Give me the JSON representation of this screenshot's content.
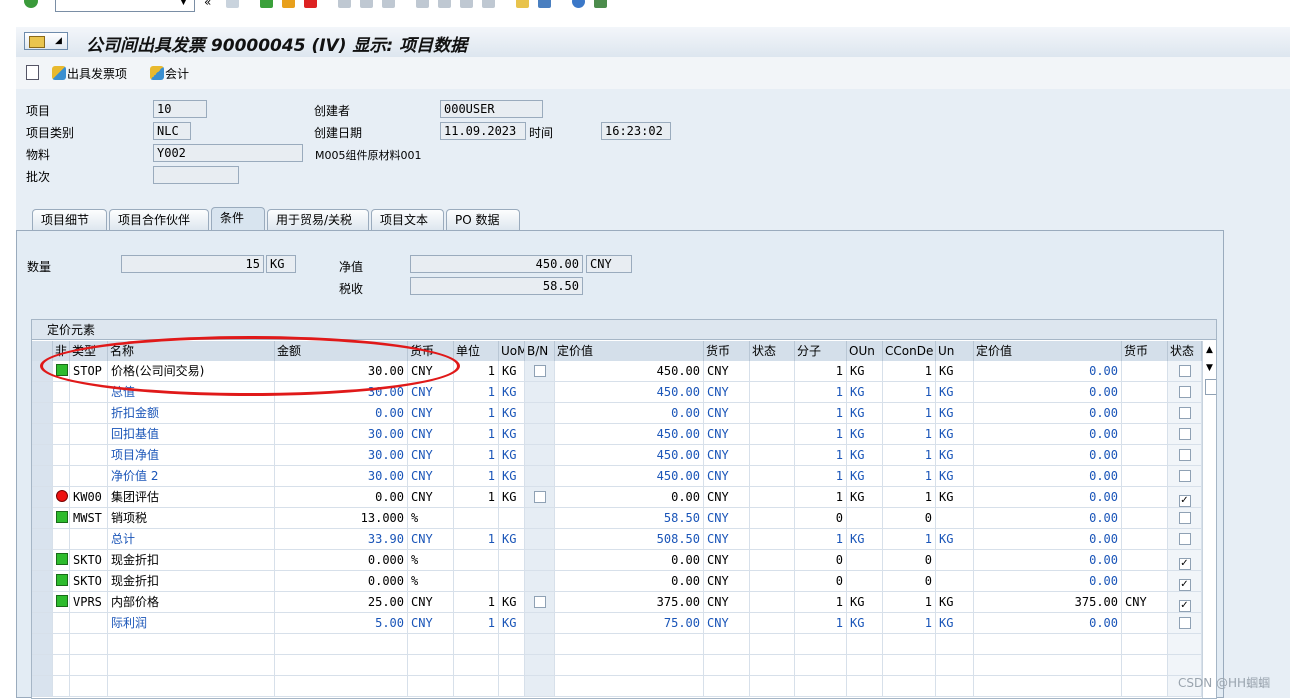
{
  "title": "公司间出具发票 90000045 (IV) 显示: 项目数据",
  "toolbar": {
    "btn1": "出具发票项",
    "btn2": "会计"
  },
  "header_fields": {
    "item_label": "项目",
    "item_value": "10",
    "category_label": "项目类别",
    "category_value": "NLC",
    "material_label": "物料",
    "material_value": "Y002",
    "material_desc": "M005组件原材料001",
    "batch_label": "批次",
    "batch_value": "",
    "creator_label": "创建者",
    "creator_value": "000USER",
    "created_label": "创建日期",
    "created_value": "11.09.2023",
    "time_label": "时间",
    "time_value": "16:23:02"
  },
  "tabs": [
    "项目细节",
    "项目合作伙伴",
    "条件",
    "用于贸易/关税",
    "项目文本",
    "PO 数据"
  ],
  "active_tab": 2,
  "conditions_header": {
    "qty_label": "数量",
    "qty_value": "15",
    "qty_unit": "KG",
    "net_label": "净值",
    "net_value": "450.00",
    "net_curr": "CNY",
    "tax_label": "税收",
    "tax_value": "58.50"
  },
  "grid": {
    "title": "定价元素",
    "columns": [
      "非",
      "类型",
      "名称",
      "金额",
      "货币",
      "单位",
      "UoM",
      "B/N",
      "定价值",
      "货币",
      "状态",
      "分子",
      "OUn",
      "CConDe",
      "Un",
      "定价值",
      "货币",
      "状态"
    ],
    "rows": [
      {
        "ind": "g",
        "type": "STOP",
        "name": "价格(公司间交易)",
        "amount": "30.00",
        "curr": "CNY",
        "unit": "1",
        "uom": "KG",
        "bn": "box",
        "cval": "450.00",
        "ccurr": "CNY",
        "num": "1",
        "oun": "KG",
        "ccon": "1",
        "un": "KG",
        "cval2": "0.00",
        "curr2": "",
        "chk": false,
        "blue": false
      },
      {
        "ind": "",
        "type": "",
        "name": "总值",
        "amount": "30.00",
        "curr": "CNY",
        "unit": "1",
        "uom": "KG",
        "bn": "",
        "cval": "450.00",
        "ccurr": "CNY",
        "num": "1",
        "oun": "KG",
        "ccon": "1",
        "un": "KG",
        "cval2": "0.00",
        "curr2": "",
        "chk": false,
        "blue": true
      },
      {
        "ind": "",
        "type": "",
        "name": "折扣金额",
        "amount": "0.00",
        "curr": "CNY",
        "unit": "1",
        "uom": "KG",
        "bn": "",
        "cval": "0.00",
        "ccurr": "CNY",
        "num": "1",
        "oun": "KG",
        "ccon": "1",
        "un": "KG",
        "cval2": "0.00",
        "curr2": "",
        "chk": false,
        "blue": true
      },
      {
        "ind": "",
        "type": "",
        "name": "回扣基值",
        "amount": "30.00",
        "curr": "CNY",
        "unit": "1",
        "uom": "KG",
        "bn": "",
        "cval": "450.00",
        "ccurr": "CNY",
        "num": "1",
        "oun": "KG",
        "ccon": "1",
        "un": "KG",
        "cval2": "0.00",
        "curr2": "",
        "chk": false,
        "blue": true
      },
      {
        "ind": "",
        "type": "",
        "name": "项目净值",
        "amount": "30.00",
        "curr": "CNY",
        "unit": "1",
        "uom": "KG",
        "bn": "",
        "cval": "450.00",
        "ccurr": "CNY",
        "num": "1",
        "oun": "KG",
        "ccon": "1",
        "un": "KG",
        "cval2": "0.00",
        "curr2": "",
        "chk": false,
        "blue": true
      },
      {
        "ind": "",
        "type": "",
        "name": "净价值 2",
        "amount": "30.00",
        "curr": "CNY",
        "unit": "1",
        "uom": "KG",
        "bn": "",
        "cval": "450.00",
        "ccurr": "CNY",
        "num": "1",
        "oun": "KG",
        "ccon": "1",
        "un": "KG",
        "cval2": "0.00",
        "curr2": "",
        "chk": false,
        "blue": true
      },
      {
        "ind": "r",
        "type": "KW00",
        "name": "集团评估",
        "amount": "0.00",
        "curr": "CNY",
        "unit": "1",
        "uom": "KG",
        "bn": "box",
        "cval": "0.00",
        "ccurr": "CNY",
        "num": "1",
        "oun": "KG",
        "ccon": "1",
        "un": "KG",
        "cval2": "0.00",
        "curr2": "",
        "chk": true,
        "blue": false
      },
      {
        "ind": "g",
        "type": "MWST",
        "name": "销项税",
        "amount": "13.000",
        "curr": "%",
        "unit": "",
        "uom": "",
        "bn": "",
        "cval": "58.50",
        "ccurr": "CNY",
        "num": "0",
        "oun": "",
        "ccon": "0",
        "un": "",
        "cval2": "0.00",
        "curr2": "",
        "chk": false,
        "blue": false,
        "cvalblue": true
      },
      {
        "ind": "",
        "type": "",
        "name": "总计",
        "amount": "33.90",
        "curr": "CNY",
        "unit": "1",
        "uom": "KG",
        "bn": "",
        "cval": "508.50",
        "ccurr": "CNY",
        "num": "1",
        "oun": "KG",
        "ccon": "1",
        "un": "KG",
        "cval2": "0.00",
        "curr2": "",
        "chk": false,
        "blue": true
      },
      {
        "ind": "g",
        "type": "SKTO",
        "name": "现金折扣",
        "amount": "0.000",
        "curr": "%",
        "unit": "",
        "uom": "",
        "bn": "",
        "cval": "0.00",
        "ccurr": "CNY",
        "num": "0",
        "oun": "",
        "ccon": "0",
        "un": "",
        "cval2": "0.00",
        "curr2": "",
        "chk": true,
        "blue": false
      },
      {
        "ind": "g",
        "type": "SKTO",
        "name": "现金折扣",
        "amount": "0.000",
        "curr": "%",
        "unit": "",
        "uom": "",
        "bn": "",
        "cval": "0.00",
        "ccurr": "CNY",
        "num": "0",
        "oun": "",
        "ccon": "0",
        "un": "",
        "cval2": "0.00",
        "curr2": "",
        "chk": true,
        "blue": false
      },
      {
        "ind": "g",
        "type": "VPRS",
        "name": "内部价格",
        "amount": "25.00",
        "curr": "CNY",
        "unit": "1",
        "uom": "KG",
        "bn": "box",
        "cval": "375.00",
        "ccurr": "CNY",
        "num": "1",
        "oun": "KG",
        "ccon": "1",
        "un": "KG",
        "cval2": "375.00",
        "curr2": "CNY",
        "chk": true,
        "blue": false
      },
      {
        "ind": "",
        "type": "",
        "name": "际利润",
        "amount": "5.00",
        "curr": "CNY",
        "unit": "1",
        "uom": "KG",
        "bn": "",
        "cval": "75.00",
        "ccurr": "CNY",
        "num": "1",
        "oun": "KG",
        "ccon": "1",
        "un": "KG",
        "cval2": "0.00",
        "curr2": "",
        "chk": false,
        "blue": true
      }
    ]
  },
  "watermark": "CSDN @HH蝈蝈"
}
